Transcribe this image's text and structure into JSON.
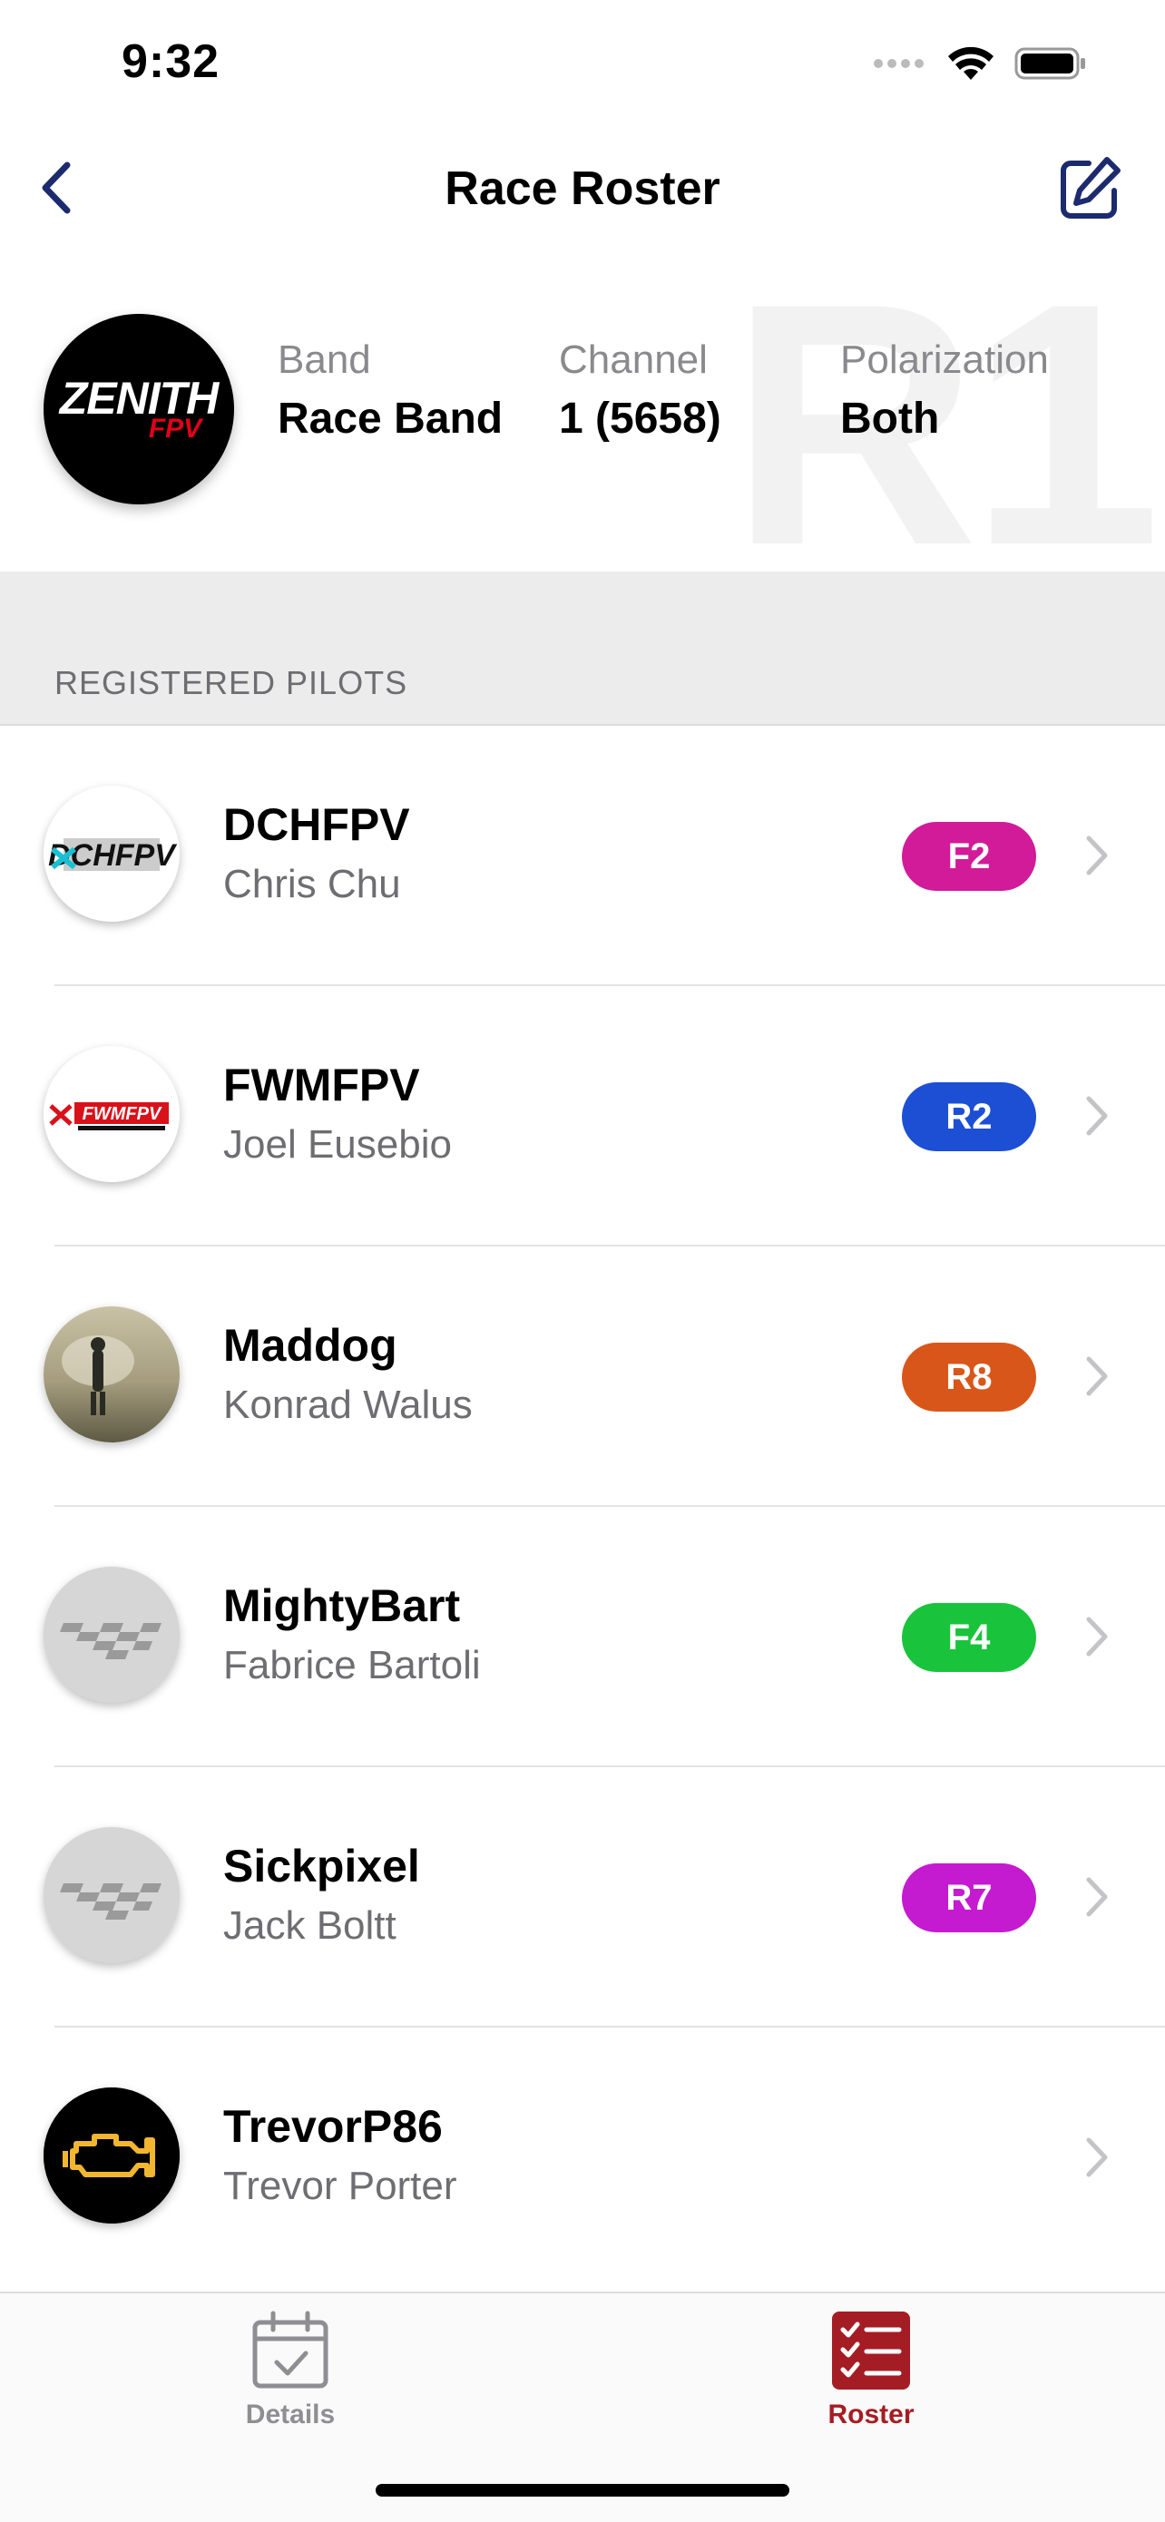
{
  "status_bar": {
    "time": "9:32"
  },
  "nav": {
    "title": "Race Roster",
    "back_icon": "chevron-left-icon",
    "edit_icon": "edit-icon"
  },
  "colors": {
    "accent": "#1c2a6e",
    "tab_active": "#a51d24",
    "tab_inactive": "#8e8e93"
  },
  "header": {
    "team_logo_text": "ZENITH FPV",
    "watermark": "R1",
    "band_label": "Band",
    "band_value": "Race Band",
    "channel_label": "Channel",
    "channel_value": "1 (5658)",
    "polarization_label": "Polarization",
    "polarization_value": "Both"
  },
  "section": {
    "title": "REGISTERED PILOTS"
  },
  "pilots": [
    {
      "callsign": "DCHFPV",
      "name": "Chris Chu",
      "channel": "F2",
      "color": "#d11b99"
    },
    {
      "callsign": "FWMFPV",
      "name": "Joel Eusebio",
      "channel": "R2",
      "color": "#1c4fd4"
    },
    {
      "callsign": "Maddog",
      "name": "Konrad Walus",
      "channel": "R8",
      "color": "#d9561a"
    },
    {
      "callsign": "MightyBart",
      "name": "Fabrice Bartoli",
      "channel": "F4",
      "color": "#19c43c"
    },
    {
      "callsign": "Sickpixel",
      "name": "Jack Boltt",
      "channel": "R7",
      "color": "#c41ad0"
    },
    {
      "callsign": "TrevorP86",
      "name": "Trevor Porter",
      "channel": "",
      "color": ""
    }
  ],
  "tabs": [
    {
      "label": "Details",
      "icon": "calendar-check-icon"
    },
    {
      "label": "Roster",
      "icon": "checklist-icon"
    }
  ]
}
